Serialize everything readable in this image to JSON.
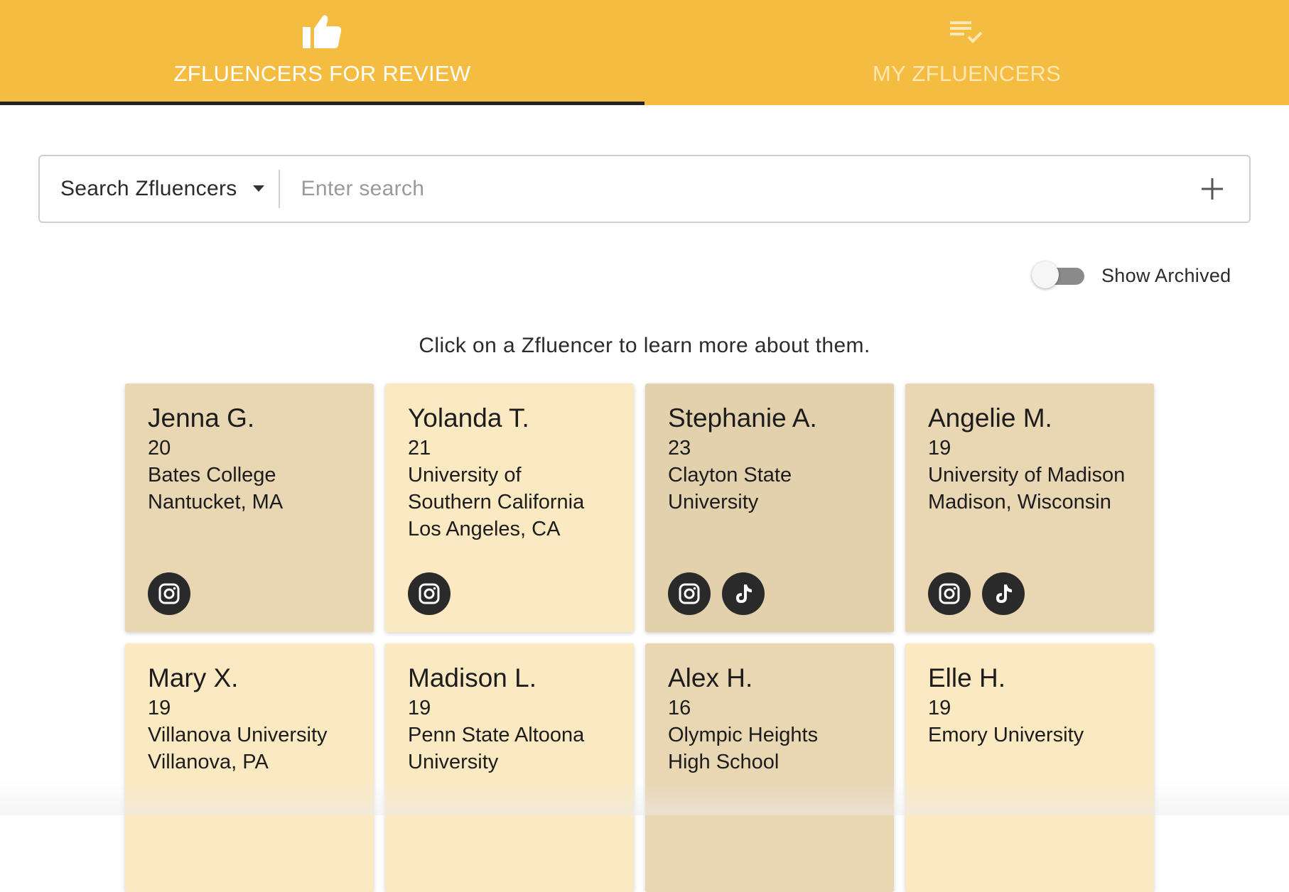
{
  "tabs": [
    {
      "label": "ZFLUENCERS FOR REVIEW",
      "icon": "thumbs-up-icon",
      "active": true
    },
    {
      "label": "MY ZFLUENCERS",
      "icon": "playlist-check-icon",
      "active": false
    }
  ],
  "search": {
    "select_label": "Search Zfluencers",
    "placeholder": "Enter search",
    "value": ""
  },
  "archived_toggle": {
    "label": "Show Archived",
    "on": false
  },
  "instruction": "Click on a Zfluencer to learn more about them.",
  "colors": {
    "accent": "#f5bc42",
    "card_a": "#e9d6b2",
    "card_b": "#fbe9c2",
    "card_c": "#e3d1ad",
    "social_bg": "#2a2a2a"
  },
  "zfluencers": [
    {
      "name": "Jenna G.",
      "lines": [
        "20",
        "Bates College",
        "Nantucket, MA"
      ],
      "socials": [
        "instagram-icon"
      ],
      "bg": "#e9d6b2"
    },
    {
      "name": "Yolanda T.",
      "lines": [
        "21",
        "University of",
        "Southern California",
        "Los Angeles, CA"
      ],
      "socials": [
        "instagram-icon"
      ],
      "bg": "#fbe9c2"
    },
    {
      "name": "Stephanie A.",
      "lines": [
        "23",
        "Clayton State",
        "University"
      ],
      "socials": [
        "instagram-icon",
        "tiktok-icon"
      ],
      "bg": "#e3d1ad"
    },
    {
      "name": "Angelie M.",
      "lines": [
        "19",
        "University of Madison",
        "Madison, Wisconsin"
      ],
      "socials": [
        "instagram-icon",
        "tiktok-icon"
      ],
      "bg": "#e9d6b2"
    },
    {
      "name": "Mary X.",
      "lines": [
        "19",
        "Villanova University",
        "Villanova, PA"
      ],
      "socials": [],
      "bg": "#fbe9c2"
    },
    {
      "name": "Madison L.",
      "lines": [
        "19",
        "Penn State Altoona",
        "University"
      ],
      "socials": [],
      "bg": "#fbe9c2"
    },
    {
      "name": "Alex H.",
      "lines": [
        "16",
        "Olympic Heights",
        "High School"
      ],
      "socials": [],
      "bg": "#e9d6b2"
    },
    {
      "name": "Elle H.",
      "lines": [
        "19",
        "Emory University"
      ],
      "socials": [],
      "bg": "#fbe9c2"
    }
  ]
}
